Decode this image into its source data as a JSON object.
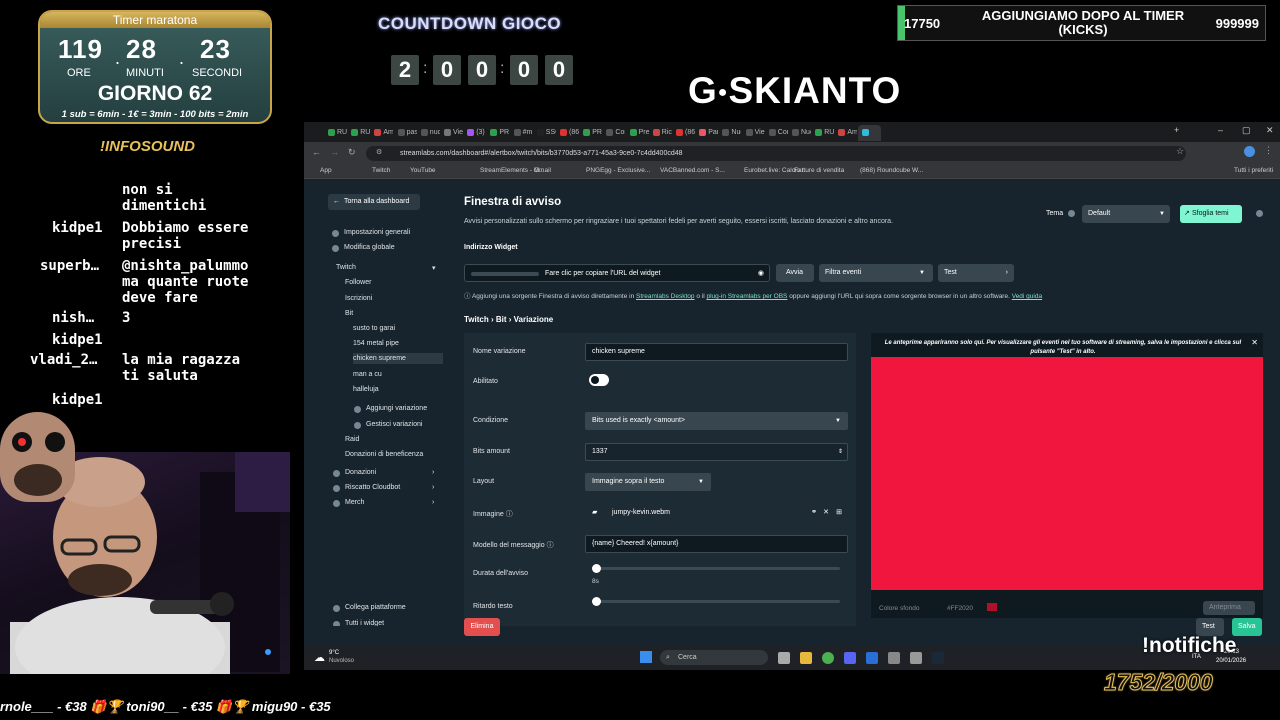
{
  "overlay": {
    "timer": {
      "title": "Timer maratona",
      "hours": "119",
      "minutes": "28",
      "seconds": "23",
      "hours_label": "ORE",
      "minutes_label": "MINUTI",
      "seconds_label": "SECONDI",
      "day": "GIORNO 62",
      "rates": "1 sub = 6min - 1€ = 3min - 100 bits = 2min"
    },
    "infosound": "!INFOSOUND",
    "countdown": {
      "title": "COUNTDOWN GIOCO",
      "digits": [
        "2",
        "0",
        "0",
        "0",
        "0"
      ]
    },
    "logo": "SKIANTO",
    "logo_letter": "G",
    "kicks": {
      "left_value": "17750",
      "text": "AGGIUNGIAMO DOPO AL TIMER (KICKS)",
      "right_value": "999999",
      "progress": 0.0178
    },
    "notifiche": "!notifiche",
    "subgoal": "1752/2000",
    "ticker": "rnole___ - €38   🎁🏆 toni90__ - €35   🎁🏆 migu90 - €35"
  },
  "chat": [
    {
      "user": "",
      "text": "non si"
    },
    {
      "user": "",
      "text": "dimentichi"
    },
    {
      "user": "kidpe1",
      "text": "Dobbiamo essere"
    },
    {
      "user": "",
      "text": "precisi"
    },
    {
      "user": "superb…",
      "text": "@nishta_palummo"
    },
    {
      "user": "",
      "text": "ma quante ruote"
    },
    {
      "user": "",
      "text": "deve fare"
    },
    {
      "user": "nish…",
      "text": "3"
    },
    {
      "user": "kidpe1",
      "text": ""
    },
    {
      "user": "vladi_2…",
      "text": "la mia ragazza"
    },
    {
      "user": "",
      "text": "ti saluta"
    },
    {
      "user": "kidpe1",
      "text": ""
    }
  ],
  "browser": {
    "tabs": [
      "RUK",
      "RUK",
      "Am",
      "pas",
      "nuc",
      "Vie",
      "(3)",
      "PRE",
      "#m",
      "SSC",
      "(86)",
      "PRE",
      "Cor",
      "Pre",
      "Ric",
      "(86)",
      "Pan",
      "Nuc",
      "Vie",
      "Cor",
      "Nuc",
      "RUK",
      "Am",
      ""
    ],
    "url": "streamlabs.com/dashboard#/alertbox/twitch/bits/b3770d53-a771-45a3-9ce0-7c4dd400cd48",
    "bookmarks": [
      "App",
      "Twitch",
      "YouTube",
      "StreamElements - M...",
      "Gmail",
      "PNGEgg - Exclusive...",
      "VACBanned.com - S...",
      "Eurobet.live: Calcio r...",
      "Fatture di vendita",
      "(868) Roundcube W...",
      "Tutti i preferiti"
    ]
  },
  "sidebar": {
    "back": "Torna alla dashboard",
    "items": [
      {
        "label": "Impostazioni generali"
      },
      {
        "label": "Modifica globale"
      },
      {
        "label": "Twitch"
      },
      {
        "label": "Follower"
      },
      {
        "label": "Iscrizioni"
      },
      {
        "label": "Bit"
      },
      {
        "label": "susto to garai"
      },
      {
        "label": "154 metal pipe"
      },
      {
        "label": "chicken supreme"
      },
      {
        "label": "man a cu"
      },
      {
        "label": "halleluja"
      },
      {
        "label": "Aggiungi variazione"
      },
      {
        "label": "Gestisci variazioni"
      },
      {
        "label": "Raid"
      },
      {
        "label": "Donazioni di beneficenza"
      },
      {
        "label": "Donazioni"
      },
      {
        "label": "Riscatto Cloudbot"
      },
      {
        "label": "Merch"
      },
      {
        "label": "Collega piattaforme"
      },
      {
        "label": "Tutti i widget"
      }
    ]
  },
  "main": {
    "title": "Finestra di avviso",
    "subtitle": "Avvisi personalizzati sullo schermo per ringraziare i tuoi spettatori fedeli per averti seguito, essersi iscritti, lasciato donazioni e altro ancora.",
    "theme_label": "Tema",
    "theme_value": "Default",
    "browse_themes": "Sfoglia temi",
    "widget_address_label": "Indirizzo Widget",
    "copy_url": "Fare clic per copiare l'URL del widget",
    "avvia": "Avvia",
    "filter_events": "Filtra eventi",
    "test": "Test",
    "hint_prefix": "Aggiungi una sorgente Finestra di avviso direttamente in",
    "hint_link1": "Streamlabs Desktop",
    "hint_mid": "o il",
    "hint_link2": "plug-in Streamlabs per OBS",
    "hint_suffix": "oppure aggiungi l'URL qui sopra come sorgente browser in un altro software.",
    "hint_link3": "Vedi guida",
    "breadcrumb": "Twitch › Bit › Variazione",
    "form": {
      "name_label": "Nome variazione",
      "name_value": "chicken supreme",
      "enabled_label": "Abilitato",
      "condition_label": "Condizione",
      "condition_value": "Bits used is exactly <amount>",
      "bits_label": "Bits amount",
      "bits_value": "1337",
      "layout_label": "Layout",
      "layout_value": "Immagine sopra il testo",
      "image_label": "Immagine",
      "image_value": "jumpy-kevin.webm",
      "message_label": "Modello del messaggio",
      "message_value": "{name} Cheered! x{amount}",
      "duration_label": "Durata dell'avviso",
      "duration_value": "8s",
      "delay_label": "Ritardo testo"
    },
    "preview": {
      "note": "Le anteprime appariranno solo qui. Per visualizzare gli eventi nel tuo software di streaming, salva le impostazioni e clicca sul pulsante \"Test\" in alto.",
      "bg_label": "Colore sfondo",
      "bg_value": "#FF2020",
      "preview_btn": "Anteprima",
      "color": "#f0163d"
    },
    "elimina": "Elimina",
    "test_btn": "Test",
    "save_btn": "Salva"
  },
  "taskbar": {
    "weather_temp": "9°C",
    "weather_desc": "Nuvoloso",
    "search": "Cerca",
    "lang": "ITA",
    "time": "20:13",
    "date": "20/01/2026"
  }
}
